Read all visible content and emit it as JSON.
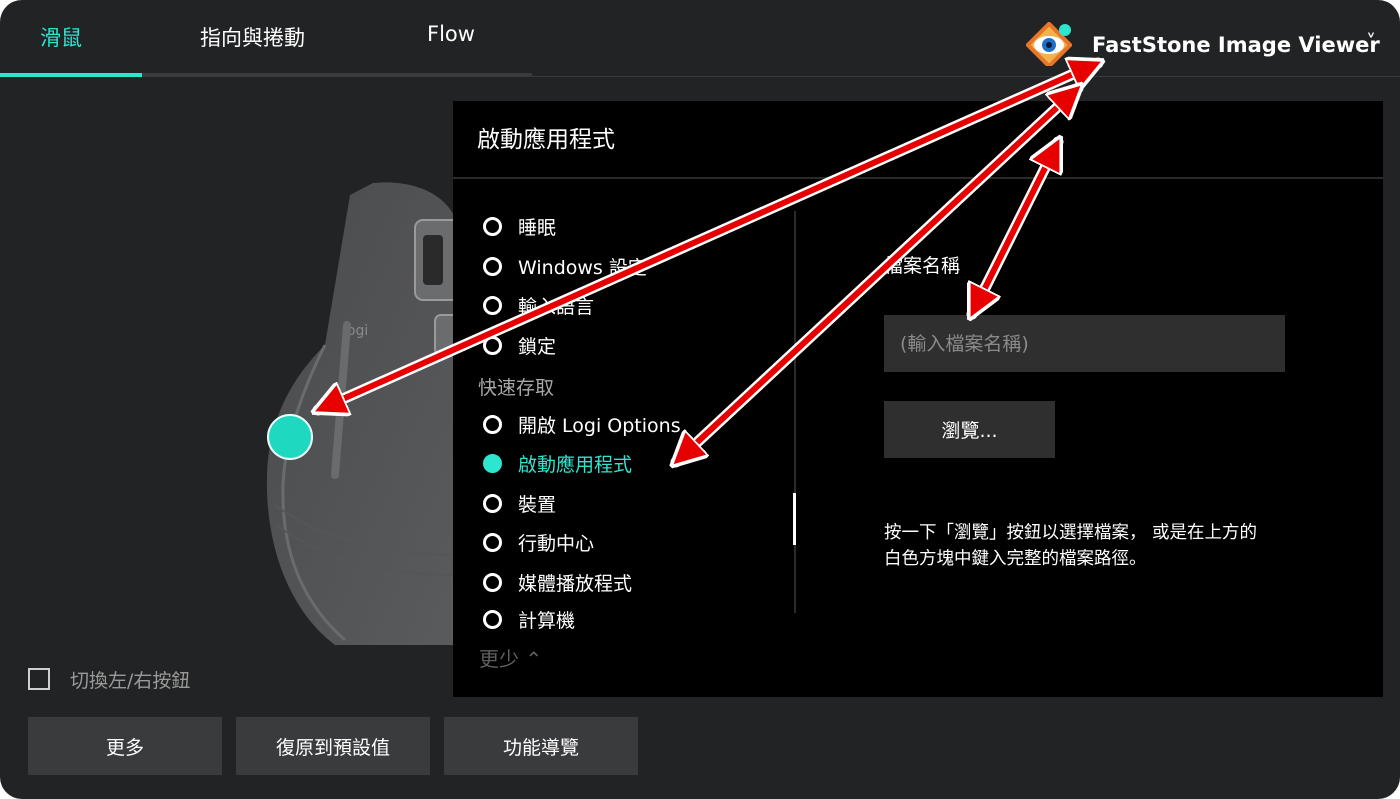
{
  "tabs": [
    {
      "label": "滑鼠",
      "active": true
    },
    {
      "label": "指向與捲動",
      "active": false
    },
    {
      "label": "Flow",
      "active": false
    }
  ],
  "app_selector": {
    "name": "FastStone Image Viewer",
    "icon": "faststone-eye-icon",
    "caret": "˅"
  },
  "swap_buttons": {
    "label": "切換左/右按鈕",
    "checked": false
  },
  "bottom_buttons": {
    "more": "更多",
    "reset": "復原到預設值",
    "tour": "功能導覽"
  },
  "panel": {
    "title": "啟動應用程式",
    "menu_items": [
      {
        "label": "睡眠",
        "selected": false
      },
      {
        "label": "Windows 設定",
        "selected": false
      },
      {
        "label": "輸入語言",
        "selected": false
      },
      {
        "label": "鎖定",
        "selected": false
      }
    ],
    "section_label": "快速存取",
    "section_items": [
      {
        "label": "開啟 Logi Options",
        "selected": false
      },
      {
        "label": "啟動應用程式",
        "selected": true
      },
      {
        "label": "裝置",
        "selected": false
      },
      {
        "label": "行動中心",
        "selected": false
      },
      {
        "label": "媒體播放程式",
        "selected": false
      },
      {
        "label": "計算機",
        "selected": false
      }
    ],
    "more_less": "更少 ⌃",
    "file_name_label": "檔案名稱",
    "file_name_value": "",
    "file_name_placeholder": "(輸入檔案名稱)",
    "browse_label": "瀏覽...",
    "help_line1": "按一下「瀏覽」按鈕以選擇檔案， 或是在上方的",
    "help_line2": "白色方塊中鍵入完整的檔案路徑。"
  },
  "colors": {
    "accent": "#2ee5cf",
    "annotation_arrow": "#e60000",
    "panel_bg": "#000000",
    "app_bg": "#222324"
  }
}
